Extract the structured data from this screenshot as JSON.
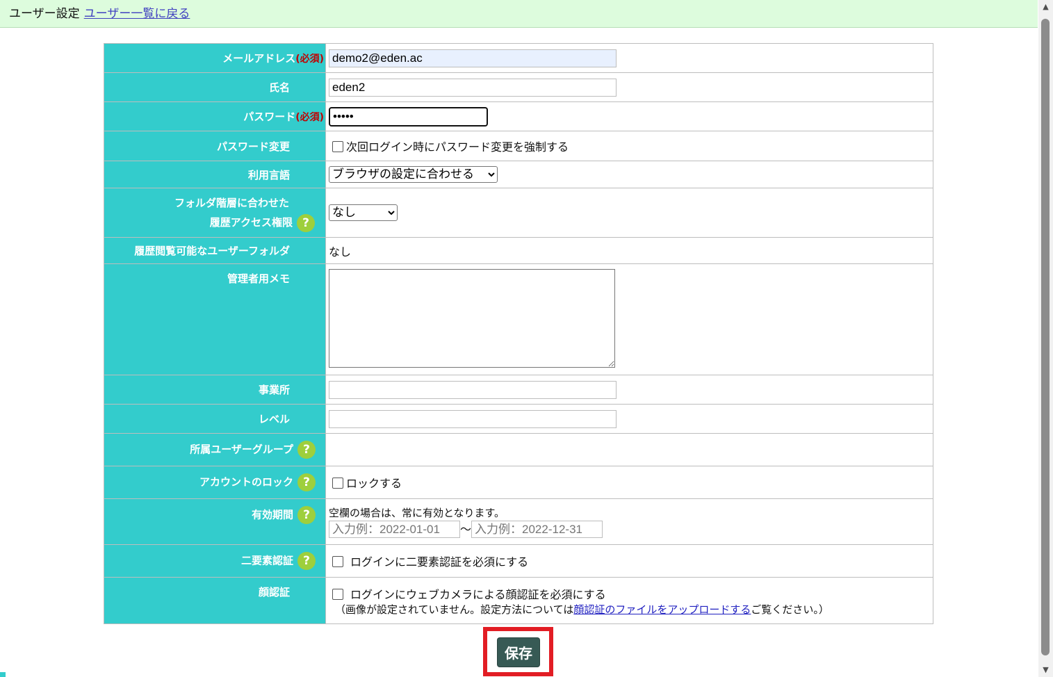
{
  "header": {
    "title": "ユーザー設定",
    "back_link": "ユーザー一覧に戻る"
  },
  "required_mark": "(必須)",
  "help_glyph": "?",
  "fields": {
    "email": {
      "label": "メールアドレス",
      "value": "demo2@eden.ac"
    },
    "name": {
      "label": "氏名",
      "value": "eden2"
    },
    "password": {
      "label": "パスワード",
      "value": "•••••"
    },
    "password_change": {
      "label": "パスワード変更",
      "checkbox_label": "次回ログイン時にパスワード変更を強制する"
    },
    "language": {
      "label": "利用言語",
      "selected": "ブラウザの設定に合わせる"
    },
    "folder_access": {
      "label_line1": "フォルダ階層に合わせた",
      "label_line2": "履歴アクセス権限",
      "selected": "なし"
    },
    "viewable_folders": {
      "label": "履歴閲覧可能なユーザーフォルダ",
      "value": "なし"
    },
    "admin_memo": {
      "label": "管理者用メモ",
      "value": ""
    },
    "office": {
      "label": "事業所",
      "value": ""
    },
    "level": {
      "label": "レベル",
      "value": ""
    },
    "user_groups": {
      "label": "所属ユーザーグループ"
    },
    "account_lock": {
      "label": "アカウントのロック",
      "checkbox_label": "ロックする"
    },
    "validity": {
      "label": "有効期間",
      "note": "空欄の場合は、常に有効となります。",
      "start_placeholder": "入力例：2022-01-01",
      "separator": "～",
      "end_placeholder": "入力例：2022-12-31"
    },
    "two_factor": {
      "label": "二要素認証",
      "checkbox_label": "ログインに二要素認証を必須にする"
    },
    "face_auth": {
      "label": "顔認証",
      "checkbox_label": "ログインにウェブカメラによる顔認証を必須にする",
      "note_prefix": "（画像が設定されていません。設定方法については",
      "note_link": "顔認証のファイルをアップロードする",
      "note_suffix": "ご覧ください。）"
    }
  },
  "save_label": "保存",
  "colors": {
    "label_bg": "#33cccc",
    "header_bg": "#ddfcdd",
    "save_bg": "#375a55",
    "highlight": "#e21d24",
    "help_bg": "#9ecf3c"
  }
}
